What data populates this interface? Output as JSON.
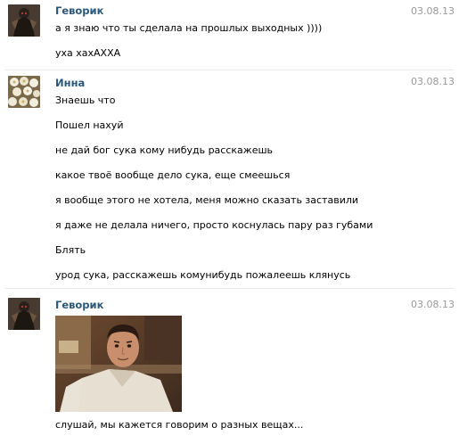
{
  "messages": [
    {
      "author": "Геворик",
      "date": "03.08.13",
      "avatar_icon": "dark-armored-warrior-avatar",
      "lines": [
        "а я знаю что ты сделала на прошлых выходных ))))",
        "уха хахАХХА"
      ]
    },
    {
      "author": "Инна",
      "date": "03.08.13",
      "avatar_icon": "white-flowers-avatar",
      "lines": [
        "Знаешь что",
        "Пошел нахуй",
        "не дай бог сука кому нибудь расскажешь",
        "какое твоё вообще дело сука, еще смеешься",
        "я вообще этого не хотела, меня можно сказать заставили",
        "я даже не делала ничего, просто коснулась пару раз губами",
        "Блять",
        "урод сука, расскажешь комунибудь пожалеешь клянусь"
      ]
    },
    {
      "author": "Геворик",
      "date": "03.08.13",
      "avatar_icon": "dark-armored-warrior-avatar",
      "attachment": "photo-of-confused-man",
      "lines": [
        "слушай, мы кажется говорим о разных вещах..."
      ]
    }
  ],
  "colors": {
    "author_link": "#2b587a",
    "date": "#999999",
    "divider": "#e7eaed",
    "text": "#000000"
  }
}
